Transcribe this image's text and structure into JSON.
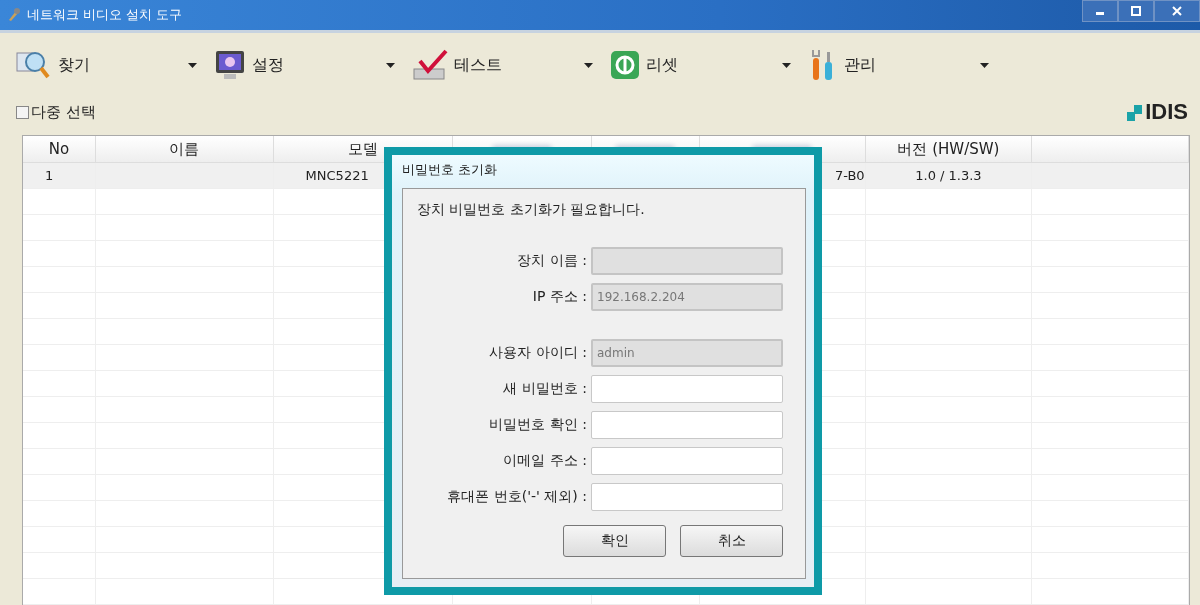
{
  "window": {
    "title": "네트워크 비디오 설치 도구"
  },
  "toolbar": [
    {
      "label": "찾기",
      "kind": "search"
    },
    {
      "label": "설정",
      "kind": "settings"
    },
    {
      "label": "테스트",
      "kind": "test"
    },
    {
      "label": "리셋",
      "kind": "reset"
    },
    {
      "label": "관리",
      "kind": "tools"
    }
  ],
  "multi_select": {
    "label": "다중 선택",
    "checked": false
  },
  "logo": {
    "text": "IDIS"
  },
  "table": {
    "columns": [
      {
        "kind": "text",
        "label": "No"
      },
      {
        "kind": "text",
        "label": "이름"
      },
      {
        "kind": "text",
        "label": "모델"
      },
      {
        "kind": "blurred"
      },
      {
        "kind": "blurred"
      },
      {
        "kind": "blurred"
      },
      {
        "kind": "text",
        "label": "버전 (HW/SW)"
      },
      {
        "kind": "blank"
      }
    ],
    "rows": [
      {
        "selected": true,
        "cells": [
          {
            "kind": "text",
            "text": "1"
          },
          {
            "kind": "blank"
          },
          {
            "kind": "text",
            "text": "MNC5221"
          },
          {
            "kind": "blank"
          },
          {
            "kind": "blank"
          },
          {
            "kind": "text",
            "text": "7-B0"
          },
          {
            "kind": "text",
            "text": "1.0 / 1.3.3"
          },
          {
            "kind": "blank"
          }
        ]
      }
    ]
  },
  "dialog": {
    "title": "비밀번호 초기화",
    "message": "장치 비밀번호 초기화가 필요합니다.",
    "field_groups": [
      [
        {
          "label": "장치 이름 :",
          "disabled": true
        },
        {
          "label": "IP 주소 :",
          "value": "192.168.2.204",
          "disabled": true
        }
      ],
      [
        {
          "label": "사용자 아이디 :",
          "value": "admin",
          "disabled": true
        },
        {
          "label": "새 비밀번호 :",
          "disabled": false
        },
        {
          "label": "비밀번호 확인 :",
          "disabled": false
        },
        {
          "label": "이메일 주소 :",
          "disabled": false
        },
        {
          "label": "휴대폰 번호('-' 제외) :",
          "disabled": false
        }
      ]
    ],
    "buttons": [
      "확인",
      "취소"
    ]
  }
}
